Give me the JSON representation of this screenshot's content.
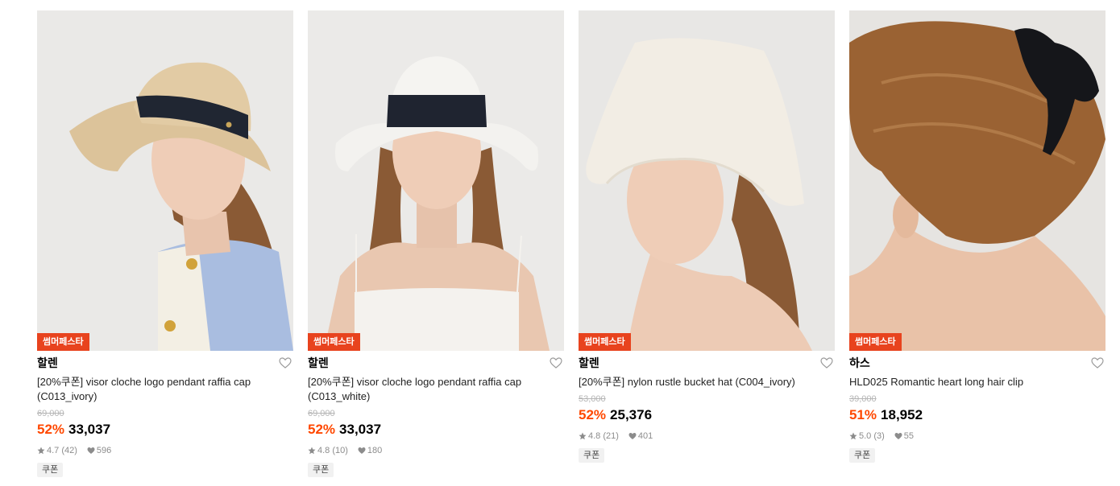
{
  "products": [
    {
      "badge": "썸머페스타",
      "brand": "할렌",
      "name": "[20%쿠폰] visor cloche logo pendant raffia cap (C013_ivory)",
      "original_price": "69,000",
      "discount": "52%",
      "price": "33,037",
      "rating": "4.7 (42)",
      "likes": "596",
      "coupon": "쿠폰"
    },
    {
      "badge": "썸머페스타",
      "brand": "할렌",
      "name": "[20%쿠폰] visor cloche logo pendant raffia cap (C013_white)",
      "original_price": "69,000",
      "discount": "52%",
      "price": "33,037",
      "rating": "4.8 (10)",
      "likes": "180",
      "coupon": "쿠폰"
    },
    {
      "badge": "썸머페스타",
      "brand": "할렌",
      "name": "[20%쿠폰] nylon rustle bucket hat (C004_ivory)",
      "original_price": "53,000",
      "discount": "52%",
      "price": "25,376",
      "rating": "4.8 (21)",
      "likes": "401",
      "coupon": "쿠폰"
    },
    {
      "badge": "썸머페스타",
      "brand": "하스",
      "name": "HLD025 Romantic heart long hair clip",
      "original_price": "39,000",
      "discount": "51%",
      "price": "18,952",
      "rating": "5.0 (3)",
      "likes": "55",
      "coupon": "쿠폰"
    }
  ],
  "colors": {
    "badge_bg": "#e8431e",
    "discount": "#ff4800",
    "muted": "#8c8c8c",
    "strike": "#b5b5b5"
  },
  "icons": {
    "wishlist": "heart-outline-icon",
    "rating": "star-icon",
    "likes": "heart-filled-icon"
  }
}
